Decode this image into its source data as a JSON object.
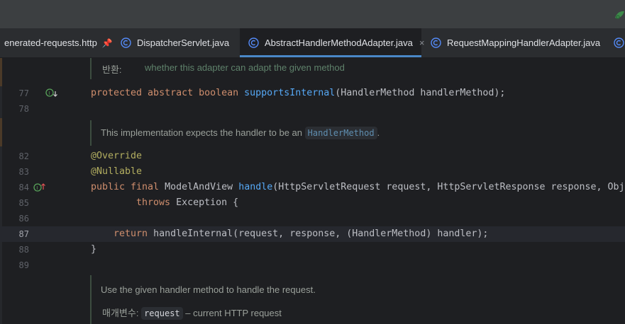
{
  "tabs": [
    {
      "label": "enerated-requests.http",
      "pinned": true,
      "pin_glyph": "📌",
      "active": false
    },
    {
      "label": "DispatcherServlet.java",
      "active": false
    },
    {
      "label": "AbstractHandlerMethodAdapter.java",
      "active": true,
      "close_glyph": "×"
    },
    {
      "label": "RequestMappingHandlerAdapter.java",
      "active": false
    }
  ],
  "colors": {
    "tab_active_underline": "#4a88c7",
    "keyword": "#cf8e6d",
    "function": "#56a8f5",
    "annotation": "#b3ae60",
    "doc_comment": "#5f826b"
  },
  "doc1": {
    "label": "반환:",
    "text": "whether this adapter can adapt the given method"
  },
  "line77": {
    "num": "77",
    "kw": "protected abstract boolean",
    "fn": "supportsInternal",
    "rest": "(HandlerMethod handlerMethod);",
    "gutter_icon": "implemented-down-icon"
  },
  "line78": {
    "num": "78"
  },
  "doc2": {
    "text": "This implementation expects the handler to be an",
    "chip": "HandlerMethod",
    "end": "."
  },
  "line82": {
    "num": "82",
    "annotation": "@Override"
  },
  "line83": {
    "num": "83",
    "annotation": "@Nullable"
  },
  "line84": {
    "num": "84",
    "kw": "public final",
    "type": "ModelAndView",
    "fn": "handle",
    "rest": "(HttpServletRequest request, HttpServletResponse response, Obj",
    "gutter_icon": "implements-up-icon"
  },
  "line85": {
    "num": "85",
    "kw": "throws",
    "rest": "Exception {"
  },
  "line86": {
    "num": "86"
  },
  "line87": {
    "num": "87",
    "kw": "return",
    "rest": "handleInternal(request, response, (HandlerMethod) handler);"
  },
  "line88": {
    "num": "88",
    "text": "}"
  },
  "line89": {
    "num": "89"
  },
  "doc3": {
    "text": "Use the given handler method to handle the request.",
    "param_label": "매개변수:",
    "param_chip": "request",
    "param_desc": "– current HTTP request"
  }
}
